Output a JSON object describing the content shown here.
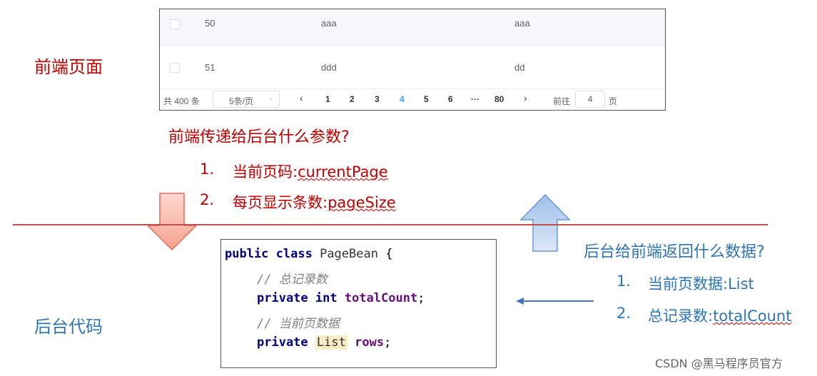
{
  "labels": {
    "frontend": "前端页面",
    "backend": "后台代码"
  },
  "table": {
    "rows": [
      {
        "id": "50",
        "col_a": "aaa",
        "col_b": "aaa"
      },
      {
        "id": "51",
        "col_a": "ddd",
        "col_b": "dd"
      }
    ],
    "pagination": {
      "total": "共 400 条",
      "page_size": "5条/页",
      "prev": "‹",
      "pages": [
        "1",
        "2",
        "3",
        "4",
        "5",
        "6",
        "···",
        "80"
      ],
      "current_page": "4",
      "next": "›",
      "goto_prefix": "前往",
      "goto_value": "4",
      "goto_suffix": "页"
    }
  },
  "frontend_question": {
    "title": "前端传递给后台什么参数?",
    "items": [
      {
        "num": "1.",
        "label": "当前页码:",
        "key": "currentPage"
      },
      {
        "num": "2.",
        "label": "每页显示条数:",
        "key": "pageSize"
      }
    ]
  },
  "code": {
    "line1": {
      "kw": "public class",
      "name": "PageBean",
      "brace": "{"
    },
    "comment1": "// 总记录数",
    "line2": {
      "kw": "private int",
      "field": "totalCount",
      "end": ";"
    },
    "comment2": "// 当前页数据",
    "line3": {
      "kw": "private",
      "type": "List",
      "field": "rows",
      "end": ";"
    }
  },
  "backend_question": {
    "title": "后台给前端返回什么数据?",
    "items": [
      {
        "num": "1.",
        "label": "当前页数据:",
        "key": "List"
      },
      {
        "num": "2.",
        "label": "总记录数:",
        "key": "totalCount"
      }
    ]
  },
  "watermark": "CSDN @黑马程序员官方",
  "colors": {
    "red": "#c00000",
    "blue": "#2e74b5",
    "active_page": "#409eff"
  },
  "icons": {
    "down_arrow": "down-arrow-icon",
    "up_arrow": "up-arrow-icon",
    "left_arrow": "left-arrow-icon"
  }
}
